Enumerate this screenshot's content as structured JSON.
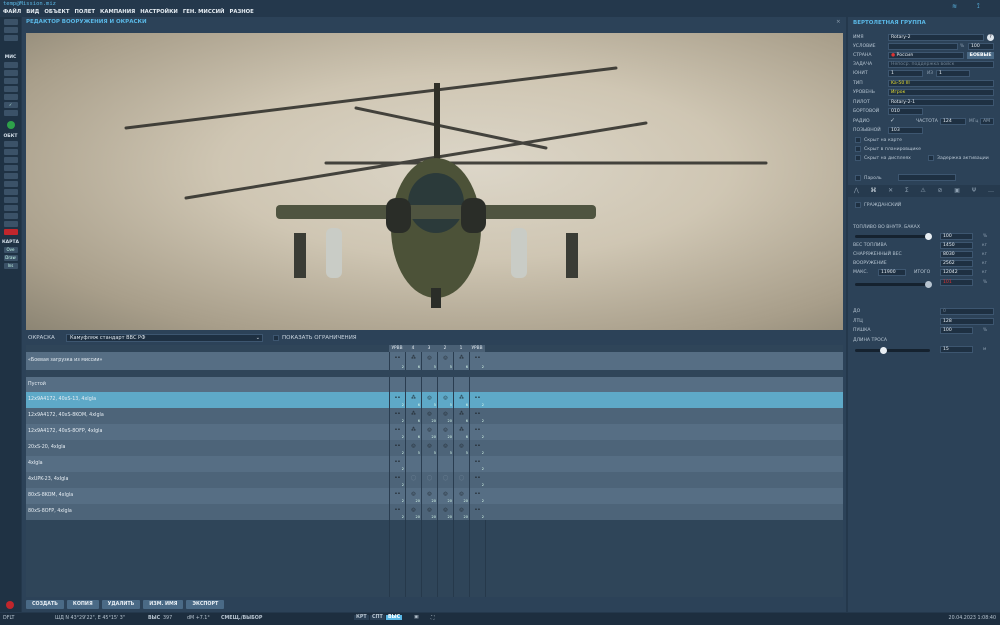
{
  "window": {
    "title": "temp@Mission.miz"
  },
  "menu": [
    "ФАЙЛ",
    "ВИД",
    "ОБЪЕКТ",
    "ПОЛЕТ",
    "КАМПАНИЯ",
    "НАСТРОЙКИ",
    "ГЕН. МИССИЙ",
    "РАЗНОЕ"
  ],
  "toolbar": {
    "mis": "МИС",
    "obj": "ОБКТ",
    "map": "КАРТА",
    "map_btns": [
      "Ove",
      "Draw",
      "Ins"
    ]
  },
  "editor": {
    "title": "РЕДАКТОР ВООРУЖЕНИЯ И ОКРАСКИ",
    "paint_label": "ОКРАСКА",
    "paint_value": "Камуфляж стандарт ВВС РФ",
    "show_limits": "ПОКАЗАТЬ ОГРАНИЧЕНИЯ"
  },
  "pylons": [
    "УРВВ",
    "4",
    "3",
    "2",
    "1",
    "УРВВ"
  ],
  "loadouts": [
    {
      "name": "«Боевая загрузка из миссии»",
      "counts": [
        "2",
        "6",
        "5",
        "5",
        "6",
        "2"
      ],
      "glyphs": [
        "m",
        "a",
        "p",
        "p",
        "a",
        "m"
      ]
    },
    {
      "name": "Пустой",
      "counts": [
        "",
        "",
        "",
        "",
        "",
        ""
      ],
      "glyphs": [
        "",
        "",
        "",
        "",
        "",
        ""
      ]
    },
    {
      "name": "12x9A4172, 40xS-13, 4xIgla",
      "counts": [
        "2",
        "6",
        "5",
        "5",
        "6",
        "2"
      ],
      "glyphs": [
        "m",
        "a",
        "p",
        "p",
        "a",
        "m"
      ],
      "selected": true
    },
    {
      "name": "12x9A4172, 40xS-8KOM, 4xIgla",
      "counts": [
        "2",
        "6",
        "20",
        "20",
        "6",
        "2"
      ],
      "glyphs": [
        "m",
        "a",
        "p",
        "p",
        "a",
        "m"
      ]
    },
    {
      "name": "12x9A4172, 40xS-8OFP, 4xIgla",
      "counts": [
        "2",
        "6",
        "20",
        "20",
        "6",
        "2"
      ],
      "glyphs": [
        "m",
        "a",
        "p",
        "p",
        "a",
        "m"
      ]
    },
    {
      "name": "20xS-20, 4xIgla",
      "counts": [
        "2",
        "5",
        "5",
        "5",
        "5",
        "2"
      ],
      "glyphs": [
        "m",
        "p",
        "p",
        "p",
        "p",
        "m"
      ]
    },
    {
      "name": "4xIgla",
      "counts": [
        "2",
        "",
        "",
        "",
        "",
        "2"
      ],
      "glyphs": [
        "m",
        "",
        "",
        "",
        "",
        "m"
      ]
    },
    {
      "name": "4xUPK-23, 4xIgla",
      "counts": [
        "2",
        "",
        "",
        "",
        "",
        "2"
      ],
      "glyphs": [
        "m",
        "g",
        "g",
        "g",
        "g",
        "m"
      ]
    },
    {
      "name": "80xS-8KOM, 4xIgla",
      "counts": [
        "2",
        "20",
        "20",
        "20",
        "20",
        "2"
      ],
      "glyphs": [
        "m",
        "p",
        "p",
        "p",
        "p",
        "m"
      ]
    },
    {
      "name": "80xS-8OFP, 4xIgla",
      "counts": [
        "2",
        "20",
        "20",
        "20",
        "20",
        "2"
      ],
      "glyphs": [
        "m",
        "p",
        "p",
        "p",
        "p",
        "m"
      ]
    }
  ],
  "buttons": [
    "СОЗДАТЬ",
    "КОПИЯ",
    "УДАЛИТЬ",
    "ИЗМ. ИМЯ",
    "ЭКСПОРТ"
  ],
  "group": {
    "title": "ВЕРТОЛЕТНАЯ ГРУППА",
    "name_label": "ИМЯ",
    "name": "Rotary-2",
    "help": "?",
    "cond_label": "УСЛОВИЕ",
    "cond_unit": "%",
    "cond_value": "100",
    "country_label": "СТРАНА",
    "country": "Россия",
    "combat_btn": "БОЕВЫЕ",
    "task_label": "ЗАДАЧА",
    "task": "Непоср. поддержка войск",
    "unit_label": "ЮНИТ",
    "unit": "1",
    "of": "ИЗ",
    "unit_total": "1",
    "type_label": "ТИП",
    "type": "Ka-50 III",
    "skill_label": "УРОВЕНЬ",
    "skill": "Игрок",
    "pilot_label": "ПИЛОТ",
    "pilot": "Rotary-2-1",
    "tail_label": "БОРТОВОЙ",
    "tail": "010",
    "radio_label": "РАДИО",
    "freq_label": "ЧАСТОТА",
    "freq": "124",
    "freq_unit": "МГц",
    "mod": "AM",
    "callsign_label": "ПОЗЫВНОЙ",
    "callsign": "103",
    "hide_map": "Скрыт на карте",
    "hide_planner": "Скрыт в планировщике",
    "hide_display": "Скрыт на дисплеях",
    "late_act": "Задержка активации",
    "password": "Пароль",
    "civil": "ГРАЖДАНСКИЙ",
    "fuel_label": "ТОПЛИВО ВО ВНУТР. БАКАХ",
    "fuel_pct": "100",
    "fuel_fraction": 1.0,
    "fuel_w_label": "ВЕС ТОПЛИВА",
    "fuel_w": "1450",
    "empty_w_label": "СНАРЯЖЕННЫЙ ВЕС",
    "empty_w": "8030",
    "weapons_label": "ВООРУЖЕНИЕ",
    "weapons_w": "2562",
    "max_label": "МАКС.",
    "max": "11900",
    "total_label": "ИТОГО",
    "total": "12042",
    "load_pct": "101",
    "kg": "кг",
    "pct": "%",
    "chaff_label": "ДО",
    "chaff": "0",
    "flares_label": "ЛТЦ",
    "flares": "128",
    "gun_label": "ПУШКА",
    "gun": "100",
    "rope_label": "ДЛИНА ТРОСА",
    "rope": "15",
    "rope_unit": "м",
    "rope_fraction": 0.35
  },
  "status": {
    "profile": "DFLT",
    "coords": "ШД  N 43°29'22\", E 45°15' 3\"",
    "alt_label": "ВЫС",
    "alt": "397",
    "dm": "dM  +7.1°",
    "mode": "СМЕЩ./ВЫБОР",
    "views": [
      "КРТ",
      "СПТ",
      "ВЫС"
    ],
    "datetime": "20.04.2023 1:08:40"
  }
}
